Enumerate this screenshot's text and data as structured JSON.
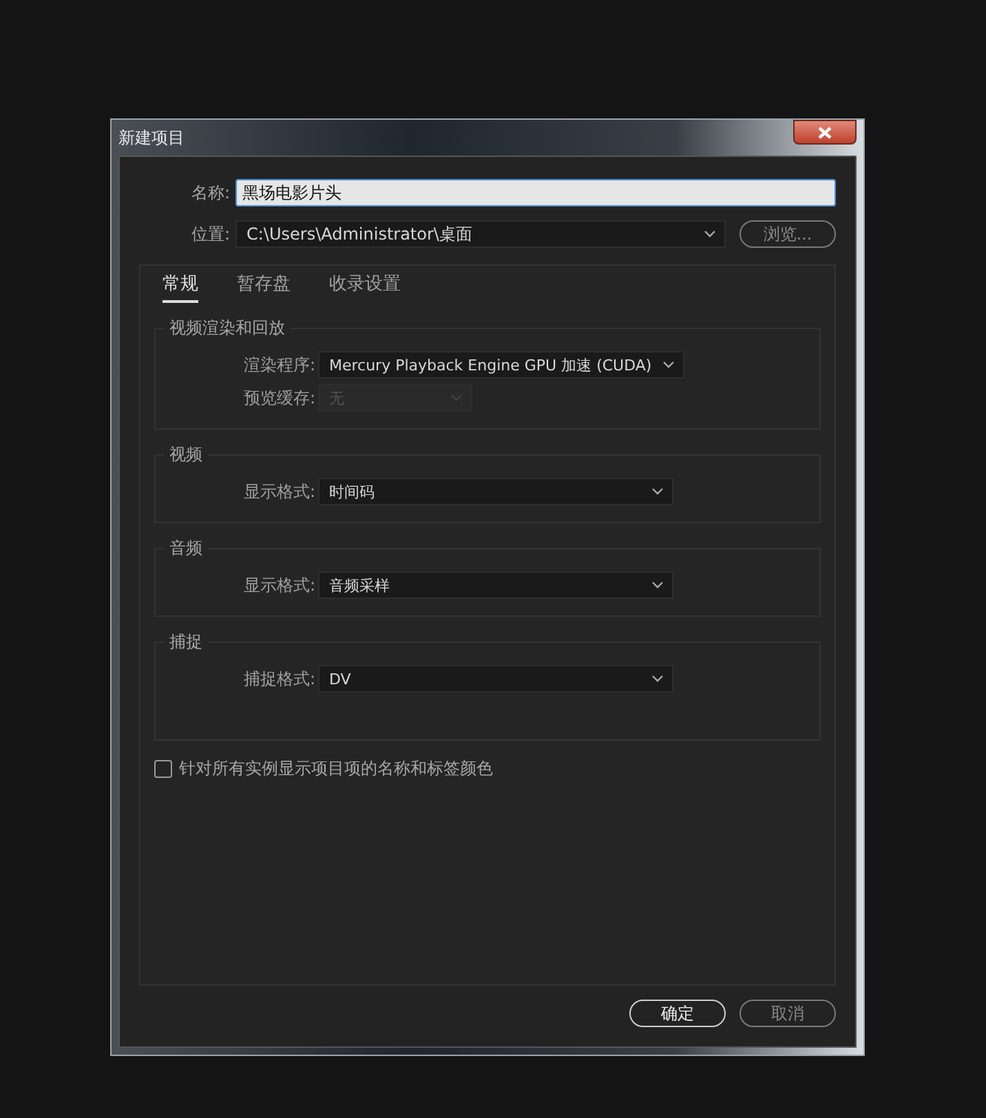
{
  "window": {
    "title": "新建项目"
  },
  "name_field": {
    "label": "名称:",
    "value": "黑场电影片头"
  },
  "location_field": {
    "label": "位置:",
    "value": "C:\\Users\\Administrator\\桌面",
    "button": "浏览..."
  },
  "tabs": [
    {
      "label": "常规",
      "selected": true
    },
    {
      "label": "暂存盘",
      "selected": false
    },
    {
      "label": "收录设置",
      "selected": false
    }
  ],
  "groups": [
    {
      "title": "视频渲染和回放",
      "rows": [
        {
          "label": "渲染程序:",
          "value": "Mercury Playback Engine GPU 加速 (CUDA)",
          "disabled": false
        },
        {
          "label": "预览缓存:",
          "value": "无",
          "disabled": true
        }
      ]
    },
    {
      "title": "视频",
      "rows": [
        {
          "label": "显示格式:",
          "value": "时间码",
          "disabled": false
        }
      ]
    },
    {
      "title": "音频",
      "rows": [
        {
          "label": "显示格式:",
          "value": "音频采样",
          "disabled": false
        }
      ]
    },
    {
      "title": "捕捉",
      "rows": [
        {
          "label": "捕捉格式:",
          "value": "DV",
          "disabled": false
        }
      ],
      "tall": true
    }
  ],
  "checkbox": {
    "label": "针对所有实例显示项目项的名称和标签颜色",
    "checked": false
  },
  "buttons": [
    {
      "label": "确定",
      "default": true
    },
    {
      "label": "取消",
      "default": false
    }
  ]
}
